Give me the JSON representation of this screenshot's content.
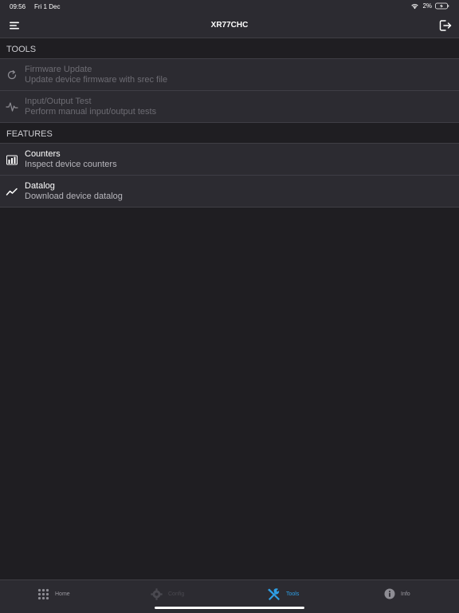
{
  "status_bar": {
    "time": "09:56",
    "date": "Fri 1 Dec",
    "battery": "2%"
  },
  "nav": {
    "title": "XR77CHC"
  },
  "sections": {
    "tools": {
      "header": "TOOLS",
      "items": [
        {
          "title": "Firmware Update",
          "subtitle": "Update device firmware with srec file",
          "icon": "refresh-icon",
          "enabled": false
        },
        {
          "title": "Input/Output Test",
          "subtitle": "Perform manual input/output tests",
          "icon": "pulse-icon",
          "enabled": false
        }
      ]
    },
    "features": {
      "header": "FEATURES",
      "items": [
        {
          "title": "Counters",
          "subtitle": "Inspect device counters",
          "icon": "bar-chart-icon",
          "enabled": true
        },
        {
          "title": "Datalog",
          "subtitle": "Download device datalog",
          "icon": "line-chart-icon",
          "enabled": true
        }
      ]
    }
  },
  "tabs": [
    {
      "label": "Home",
      "icon": "grid-icon",
      "state": "normal"
    },
    {
      "label": "Config",
      "icon": "gear-icon",
      "state": "disabled"
    },
    {
      "label": "Tools",
      "icon": "tools-icon",
      "state": "selected"
    },
    {
      "label": "Info",
      "icon": "info-icon",
      "state": "normal"
    }
  ],
  "colors": {
    "background": "#1f1e22",
    "bar": "#2c2b31",
    "accent": "#2e9fe6",
    "disabled_text": "#6d6c73",
    "subtitle_text": "#b7b6bc"
  }
}
